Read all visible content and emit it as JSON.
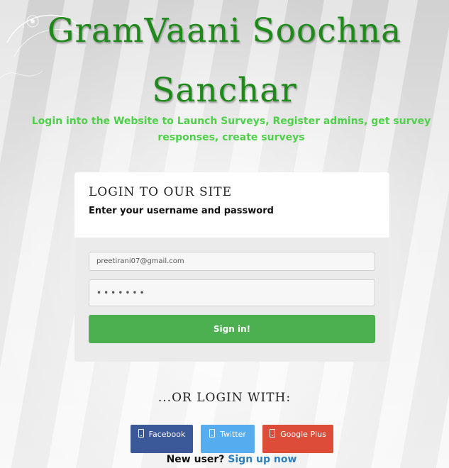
{
  "header": {
    "title_line1": "GramVaani Soochna",
    "title_line2": "Sanchar",
    "tagline": "Login into the Website to Launch Surveys, Register admins, get survey responses, create surveys"
  },
  "login_form": {
    "heading": "LOGIN TO OUR SITE",
    "subheading": "Enter your username and password",
    "email_value": "preetirani07@gmail.com",
    "password_value": "•••••••",
    "submit_label": "Sign in!"
  },
  "social_login": {
    "heading": "...OR LOGIN WITH:",
    "buttons": [
      {
        "label": "Facebook",
        "icon": "mobile-phone-icon",
        "color": "#3b5998"
      },
      {
        "label": "Twitter",
        "icon": "mobile-phone-icon",
        "color": "#55acee"
      },
      {
        "label": "Google Plus",
        "icon": "mobile-phone-icon",
        "color": "#dd4b39"
      }
    ]
  },
  "signup": {
    "prompt": "New user?",
    "link_label": "Sign up now"
  },
  "colors": {
    "title_green": "#1e8a19",
    "tagline_green": "#4fd04a",
    "signin_green": "#4caf50",
    "link_blue": "#2d7fbd"
  }
}
